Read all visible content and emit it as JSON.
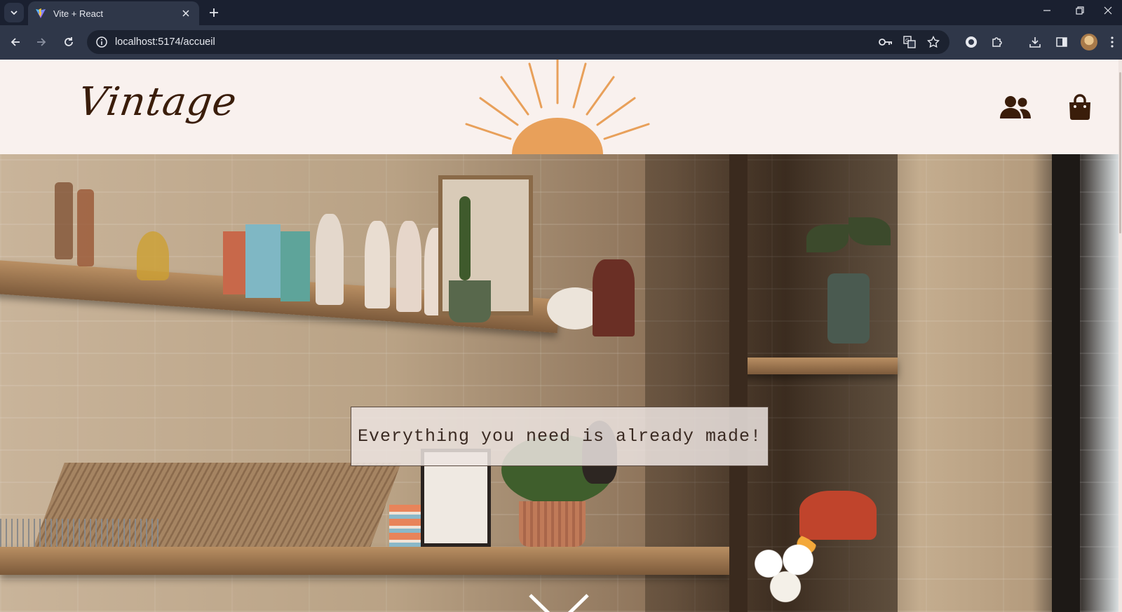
{
  "browser": {
    "tab_title": "Vite + React",
    "url": "localhost:5174/accueil"
  },
  "site": {
    "logo": "Vintage",
    "tagline": "Everything you need is already made!"
  },
  "colors": {
    "header_bg": "#f9f1ee",
    "logo_color": "#3a1d0a",
    "sun_color": "#e8a05a",
    "icon_color": "#3a1d0a"
  }
}
